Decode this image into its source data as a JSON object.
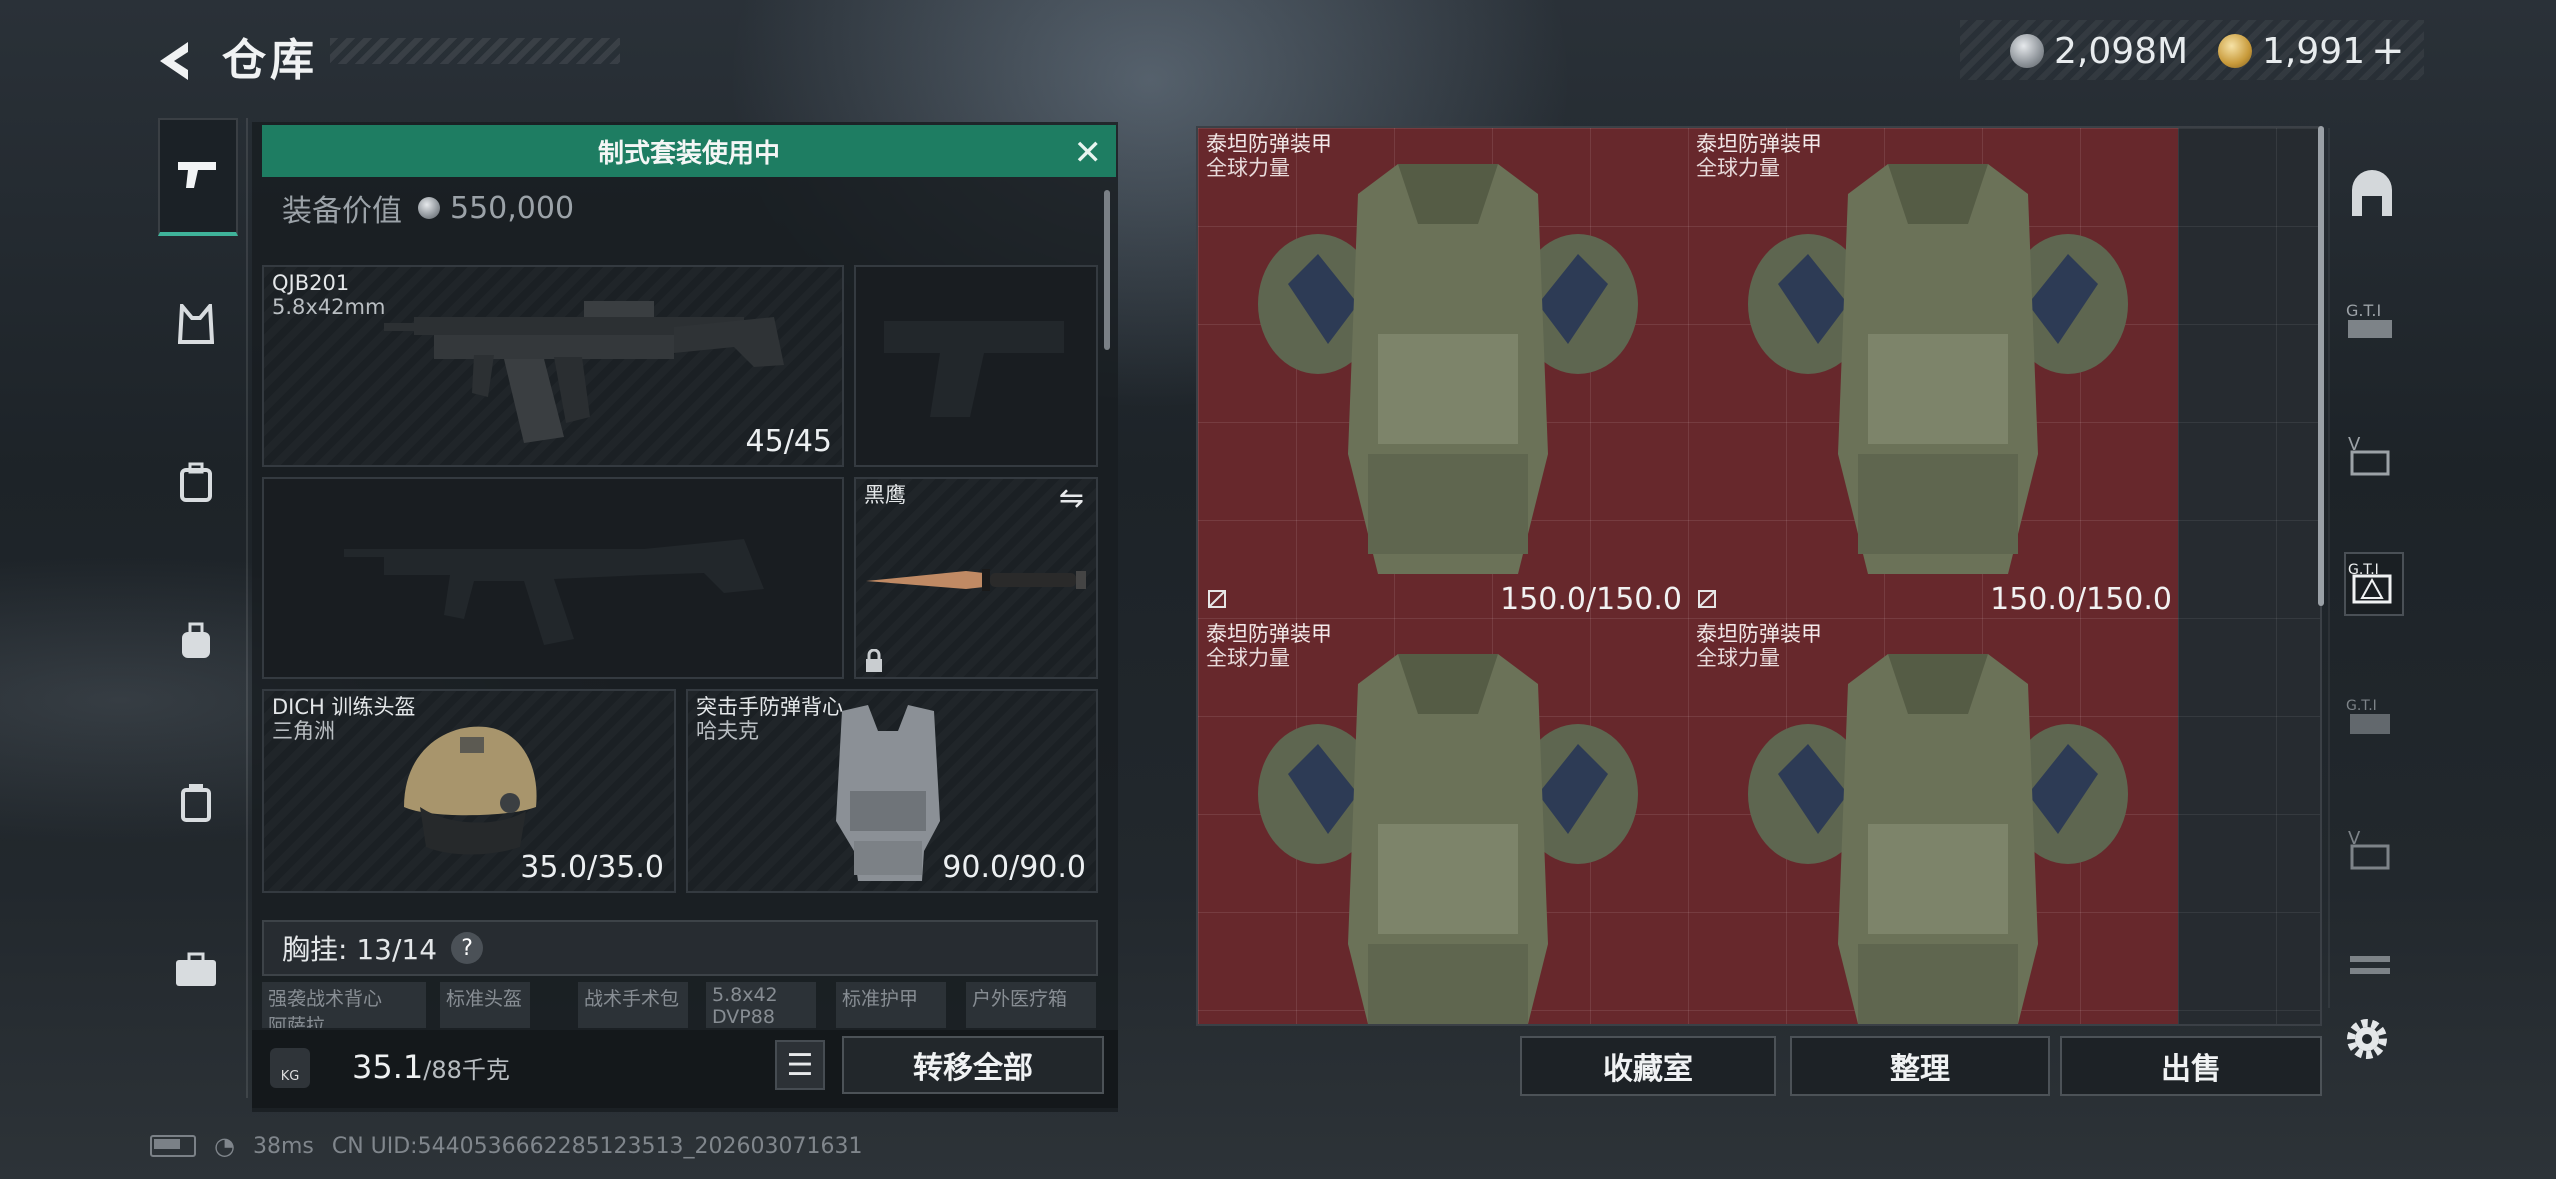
{
  "header": {
    "title": "仓库",
    "currency": [
      {
        "icon": "silver-coin-icon",
        "value": "2,098M"
      },
      {
        "icon": "gold-coin-icon",
        "value": "1,991",
        "suffix": "+"
      }
    ]
  },
  "left_tabs": [
    {
      "icon": "pistol-icon",
      "active": true
    },
    {
      "icon": "chest-rig-icon",
      "active": false
    },
    {
      "icon": "backpack-icon",
      "active": false
    },
    {
      "icon": "bag-icon",
      "active": false
    },
    {
      "icon": "case-icon",
      "active": false
    },
    {
      "icon": "briefcase-icon",
      "active": false
    }
  ],
  "loadout": {
    "banner": "制式套装使用中",
    "value_label": "装备价值",
    "value": "550,000",
    "primary_weapon": {
      "name": "QJB201",
      "caliber": "5.8x42mm",
      "ammo": "45/45"
    },
    "melee": {
      "name": "黑鹰"
    },
    "helmet": {
      "name": "DICH 训练头盔",
      "sub": "三角洲",
      "durability": "35.0/35.0"
    },
    "armor": {
      "name": "突击手防弹背心",
      "sub": "哈夫克",
      "durability": "90.0/90.0"
    },
    "rig": {
      "label": "胸挂: 13/14",
      "help": "?"
    },
    "rig_items": [
      "强袭战术背心\n阿萨拉",
      "标准头盔",
      "战术手术包",
      "5.8x42\nDVP88",
      "标准护甲",
      "户外医疗箱"
    ],
    "weight_value": "35.1",
    "weight_cap": "/88千克",
    "weight_icon_text": "KG",
    "transfer_label": "转移全部"
  },
  "storage": {
    "items": [
      {
        "name": "泰坦防弹装甲",
        "sub": "全球力量",
        "durability": "150.0/150.0"
      },
      {
        "name": "泰坦防弹装甲",
        "sub": "全球力量",
        "durability": "150.0/150.0"
      },
      {
        "name": "泰坦防弹装甲",
        "sub": "全球力量",
        "durability": ""
      },
      {
        "name": "泰坦防弹装甲",
        "sub": "全球力量",
        "durability": ""
      }
    ],
    "buttons": {
      "collection": "收藏室",
      "organize": "整理",
      "sell": "出售"
    }
  },
  "status": {
    "ping": "38ms",
    "uid": "CN UID:544053666228512351​3_202603071631"
  },
  "colors": {
    "banner": "#1e7d62",
    "accent": "#3fb39a",
    "item_bg": "#7a282c"
  }
}
